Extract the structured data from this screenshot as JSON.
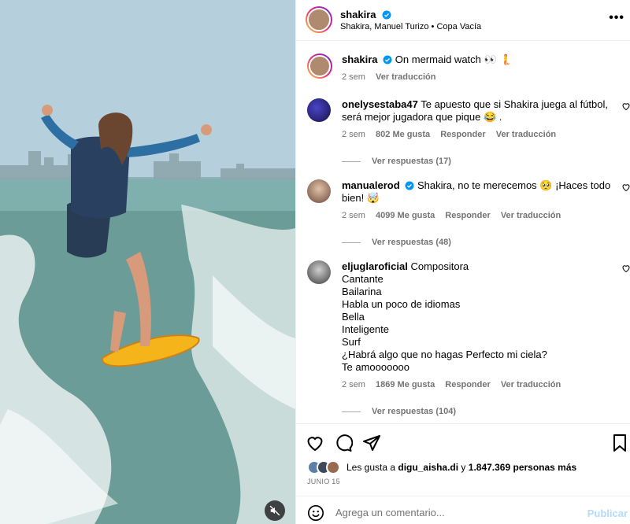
{
  "post": {
    "username": "shakira",
    "audio": "Shakira, Manuel Turizo • Copa Vacía"
  },
  "caption": {
    "username": "shakira",
    "text": "On mermaid watch 👀 🧜",
    "time": "2 sem",
    "translate": "Ver traducción"
  },
  "comments": [
    {
      "username": "onelysestaba47",
      "text": "Te apuesto que si Shakira juega al fútbol, será mejor jugadora que pique 😂 .",
      "time": "2 sem",
      "likes": "802 Me gusta",
      "reply": "Responder",
      "translate": "Ver traducción",
      "replies": "Ver respuestas (17)"
    },
    {
      "username": "manualerod",
      "text": "Shakira, no te merecemos 🥺 ¡Haces todo bien! 🤯",
      "time": "2 sem",
      "likes": "4099 Me gusta",
      "reply": "Responder",
      "translate": "Ver traducción",
      "replies": "Ver respuestas (48)"
    },
    {
      "username": "eljuglaroficial",
      "lines": [
        "Compositora",
        "Cantante",
        "Bailarina",
        "Habla un poco de idiomas",
        "Bella",
        "Inteligente",
        "Surf",
        "¿Habrá algo que no hagas Perfecto mi ciela?",
        "Te amooooooo"
      ],
      "time": "2 sem",
      "likes": "1869 Me gusta",
      "reply": "Responder",
      "translate": "Ver traducción",
      "replies": "Ver respuestas (104)"
    }
  ],
  "likes": {
    "prefix": "Les gusta a",
    "user": "digu_aisha.di",
    "connector": "y",
    "count": "1.847.369 personas más"
  },
  "date": "JUNIO 15",
  "add_comment": {
    "placeholder": "Agrega un comentario...",
    "publish": "Publicar"
  },
  "icons": {
    "heart": "heart-icon",
    "comment": "comment-icon",
    "share": "share-icon",
    "save": "bookmark-icon",
    "mute": "muted-speaker-icon",
    "more": "more-icon",
    "verified": "verified-badge-icon",
    "emoji": "emoji-icon"
  },
  "colors": {
    "verified": "#0095f6",
    "muted_text": "#737373",
    "publish": "#b3dbff"
  }
}
